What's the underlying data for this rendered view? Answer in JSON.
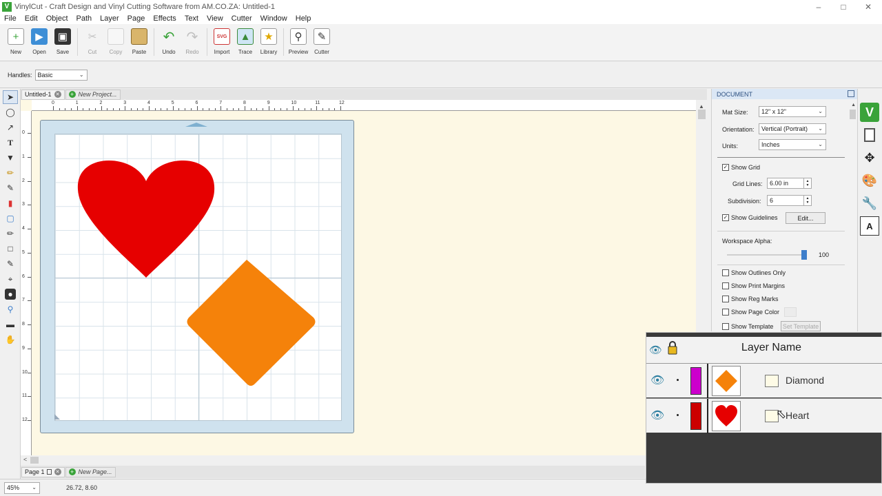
{
  "window": {
    "title": "VinylCut - Craft Design and Vinyl Cutting Software from AM.CO.ZA: Untitled-1",
    "app_icon": "V"
  },
  "menu": [
    "File",
    "Edit",
    "Object",
    "Path",
    "Layer",
    "Page",
    "Effects",
    "Text",
    "View",
    "Cutter",
    "Window",
    "Help"
  ],
  "toolbar": {
    "new": "New",
    "open": "Open",
    "save": "Save",
    "cut": "Cut",
    "copy": "Copy",
    "paste": "Paste",
    "undo": "Undo",
    "redo": "Redo",
    "import": "Import",
    "trace": "Trace",
    "library": "Library",
    "preview": "Preview",
    "cutter": "Cutter"
  },
  "options": {
    "handles_label": "Handles:",
    "handles_value": "Basic"
  },
  "tabs": {
    "doc": "Untitled-1",
    "new_project": "New Project..."
  },
  "pages": {
    "page": "Page 1",
    "new_page": "New Page..."
  },
  "ruler": {
    "top": [
      "0",
      "1",
      "2",
      "3",
      "4",
      "5",
      "6",
      "7",
      "8",
      "9",
      "10",
      "11",
      "12"
    ],
    "left": [
      "0",
      "1",
      "2",
      "3",
      "4",
      "5",
      "6",
      "7",
      "8",
      "9",
      "10",
      "11",
      "12"
    ]
  },
  "status": {
    "zoom": "45%",
    "coords": "26.72, 8.60"
  },
  "document": {
    "header": "DOCUMENT",
    "mat_size_label": "Mat Size:",
    "mat_size": "12\" x 12\"",
    "orientation_label": "Orientation:",
    "orientation": "Vertical (Portrait)",
    "units_label": "Units:",
    "units": "Inches",
    "show_grid": "Show Grid",
    "grid_lines_label": "Grid Lines:",
    "grid_lines": "6.00 in",
    "subdivision_label": "Subdivision:",
    "subdivision": "6",
    "show_guidelines": "Show Guidelines",
    "edit": "Edit...",
    "alpha_label": "Workspace Alpha:",
    "alpha": "100",
    "show_outlines": "Show Outlines Only",
    "show_print_margins": "Show Print Margins",
    "show_reg_marks": "Show Reg Marks",
    "show_page_color": "Show Page Color",
    "show_template": "Show Template",
    "set_template": "Set Template"
  },
  "layers": {
    "header": "Layer Name",
    "items": [
      {
        "name": "Diamond",
        "color": "#cc00cc",
        "shape_color": "#f5820a"
      },
      {
        "name": "Heart",
        "color": "#cc0000",
        "shape_color": "#e60000"
      }
    ]
  },
  "colors": {
    "heart": "#e60000",
    "diamond": "#f5820a",
    "accent": "#3aa33a"
  }
}
